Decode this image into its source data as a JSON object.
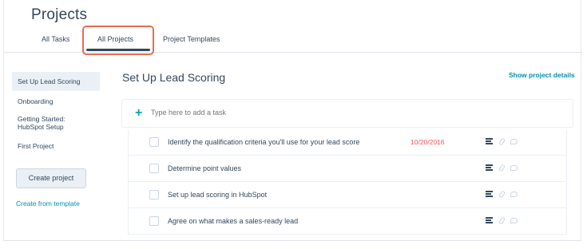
{
  "page": {
    "title": "Projects"
  },
  "tabs": [
    {
      "label": "All Tasks"
    },
    {
      "label": "All Projects",
      "active": true
    },
    {
      "label": "Project Templates"
    }
  ],
  "sidebar": {
    "items": [
      {
        "label": "Set Up Lead Scoring",
        "active": true
      },
      {
        "label": "Onboarding"
      },
      {
        "label": "Getting Started: HubSpot Setup"
      },
      {
        "label": "First Project"
      }
    ],
    "create_button": "Create project",
    "create_from_template": "Create from template"
  },
  "main": {
    "title": "Set Up Lead Scoring",
    "show_details": "Show project details",
    "add_task_placeholder": "Type here to add a task"
  },
  "tasks": [
    {
      "text": "Identify the qualification criteria you'll use for your lead score",
      "due": "10/20/2016"
    },
    {
      "text": "Determine point values",
      "due": ""
    },
    {
      "text": "Set up lead scoring in HubSpot",
      "due": ""
    },
    {
      "text": "Agree on what makes a sales-ready lead",
      "due": ""
    }
  ],
  "colors": {
    "accent": "#0091ae",
    "highlight": "#e66e50",
    "due": "#f2545b",
    "text": "#33475b"
  }
}
